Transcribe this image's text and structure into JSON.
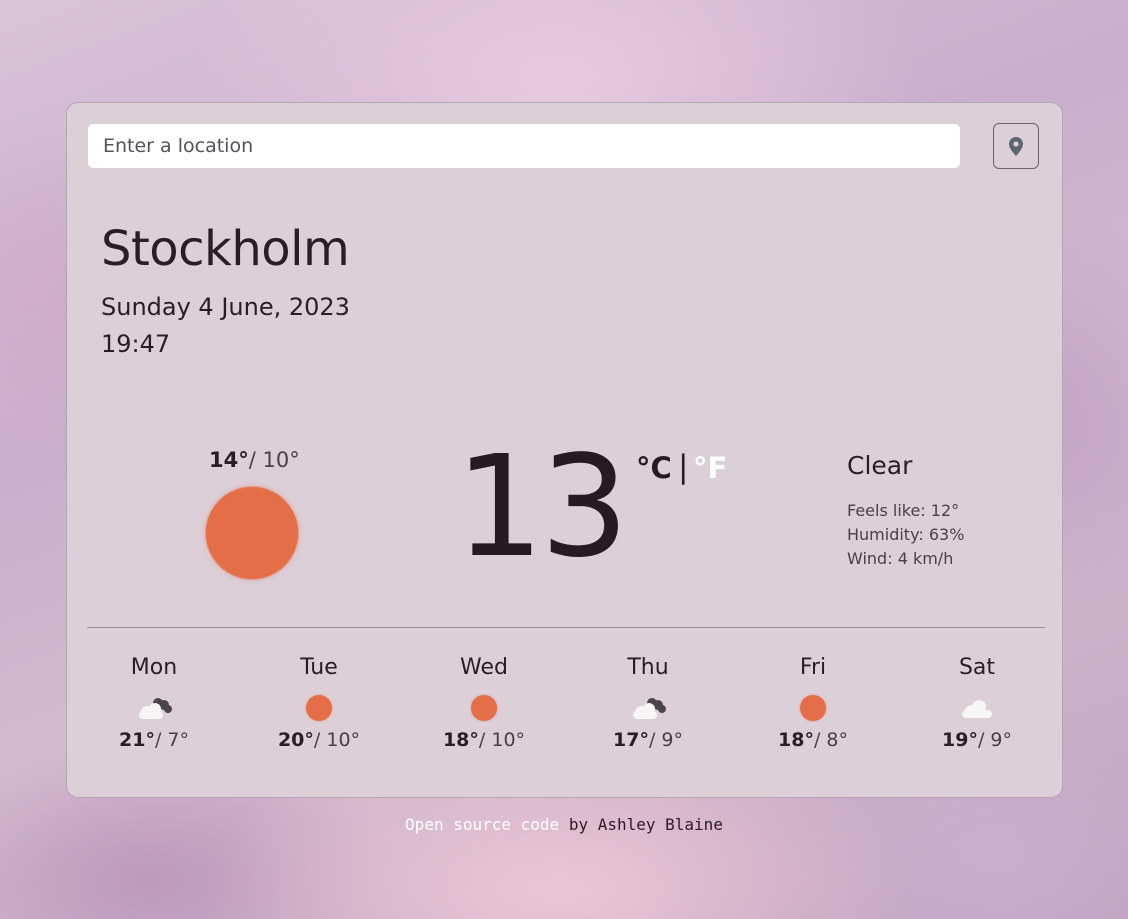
{
  "search": {
    "placeholder": "Enter a location",
    "value": ""
  },
  "location_button": {
    "icon": "map-pin-icon"
  },
  "current": {
    "city": "Stockholm",
    "date": "Sunday 4 June, 2023",
    "time": "19:47",
    "high": "14°",
    "low": "10°",
    "temperature": "13",
    "unit_celsius": "°C",
    "unit_separator": "|",
    "unit_fahrenheit": "°F",
    "condition": "Clear",
    "icon": "sun-icon",
    "feels_like": "Feels like: 12°",
    "humidity": "Humidity: 63%",
    "wind": "Wind: 4 km/h"
  },
  "forecast": [
    {
      "day": "Mon",
      "icon": "cloud-night-icon",
      "high": "21°",
      "low": "7°"
    },
    {
      "day": "Tue",
      "icon": "sun-icon",
      "high": "20°",
      "low": "10°"
    },
    {
      "day": "Wed",
      "icon": "sun-icon",
      "high": "18°",
      "low": "10°"
    },
    {
      "day": "Thu",
      "icon": "cloud-night-icon",
      "high": "17°",
      "low": "9°"
    },
    {
      "day": "Fri",
      "icon": "sun-icon",
      "high": "18°",
      "low": "8°"
    },
    {
      "day": "Sat",
      "icon": "cloud-icon",
      "high": "19°",
      "low": "9°"
    }
  ],
  "footer": {
    "link_text": "Open source code",
    "by_text": "by",
    "author": "Ashley Blaine"
  },
  "colors": {
    "sun": "#e46e48",
    "card": "#ddd0d8",
    "text": "#2a1d25",
    "active_unit": "#ffffff"
  }
}
